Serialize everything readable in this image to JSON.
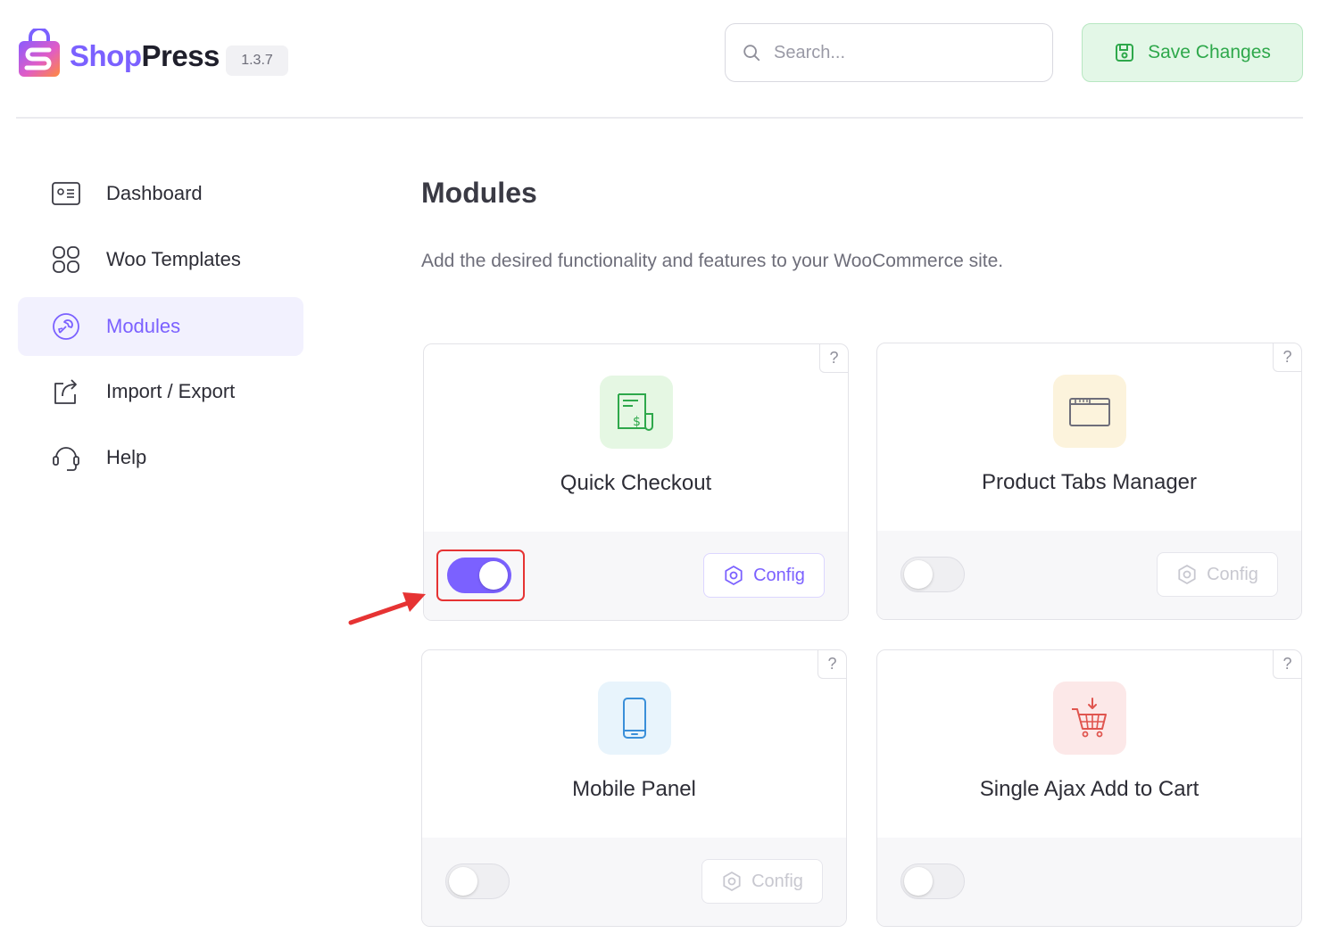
{
  "header": {
    "brand_shop": "Shop",
    "brand_press": "Press",
    "version": "1.3.7",
    "search_placeholder": "Search...",
    "save_label": "Save Changes"
  },
  "sidebar": {
    "items": [
      {
        "label": "Dashboard",
        "icon": "dashboard-card-icon",
        "active": false
      },
      {
        "label": "Woo Templates",
        "icon": "grid-icon",
        "active": false
      },
      {
        "label": "Modules",
        "icon": "modules-icon",
        "active": true
      },
      {
        "label": "Import / Export",
        "icon": "import-export-icon",
        "active": false
      },
      {
        "label": "Help",
        "icon": "headset-icon",
        "active": false
      }
    ]
  },
  "main": {
    "title": "Modules",
    "description": "Add the desired functionality and features to your WooCommerce site.",
    "modules": [
      {
        "title": "Quick Checkout",
        "icon": "checkout-receipt-icon",
        "enabled": true,
        "config_label": "Config",
        "help": "?"
      },
      {
        "title": "Product Tabs Manager",
        "icon": "folder-tabs-icon",
        "enabled": false,
        "config_label": "Config",
        "help": "?"
      },
      {
        "title": "Mobile Panel",
        "icon": "mobile-phone-icon",
        "enabled": false,
        "config_label": "Config",
        "help": "?"
      },
      {
        "title": "Single Ajax Add to Cart",
        "icon": "cart-add-icon",
        "enabled": false,
        "help": "?"
      }
    ]
  },
  "colors": {
    "accent": "#7b61ff",
    "save_green": "#2ea84b",
    "annotation_red": "#e63333"
  }
}
